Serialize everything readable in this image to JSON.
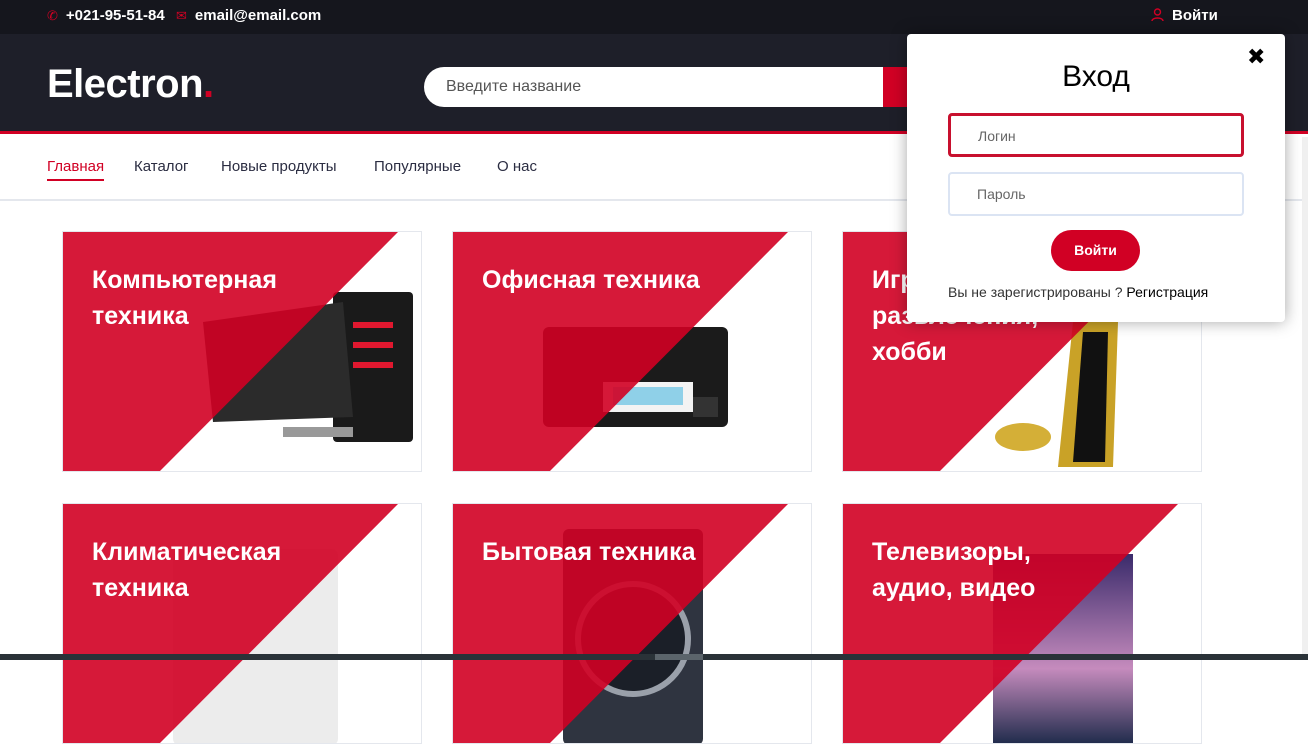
{
  "topbar": {
    "phone": "+021-95-51-84",
    "email": "email@email.com",
    "login": "Войти"
  },
  "header": {
    "logo": "Electron",
    "logo_dot": ".",
    "search_placeholder": "Введите название"
  },
  "nav": {
    "items": [
      "Главная",
      "Каталог",
      "Новые продукты",
      "Популярные",
      "О нас"
    ],
    "active": "Главная"
  },
  "categories": [
    {
      "title": "Компьютерная техника"
    },
    {
      "title": "Офисная техника"
    },
    {
      "title": "Игры, развлечения, хобби"
    },
    {
      "title": "Климатическая техника"
    },
    {
      "title": "Бытовая техника"
    },
    {
      "title": "Телевизоры, аудио, видео"
    }
  ],
  "login_modal": {
    "title": "Вход",
    "close": "✖",
    "login_placeholder": "Логин",
    "password_placeholder": "Пароль",
    "submit": "Войти",
    "not_registered": "Вы не зарегистрированы ? ",
    "register": "Регистрация"
  },
  "colors": {
    "accent": "#d10024",
    "dark": "#15161d",
    "header": "#1e1f29"
  }
}
